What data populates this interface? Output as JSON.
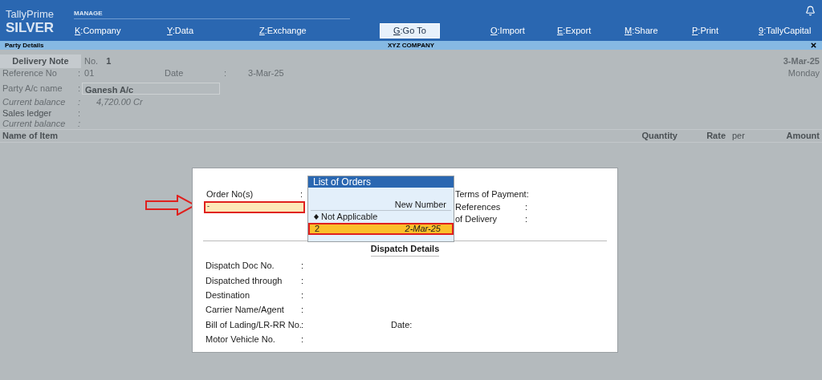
{
  "header": {
    "product": "TallyPrime",
    "edition": "SILVER",
    "section": "MANAGE",
    "menu": [
      {
        "key": "K",
        "label": ":Company",
        "selected": false
      },
      {
        "key": "Y",
        "label": ":Data",
        "selected": false
      },
      {
        "key": "Z",
        "label": ":Exchange",
        "selected": false
      },
      {
        "key": "G",
        "label": ":Go To",
        "selected": true
      },
      {
        "key": "O",
        "label": ":Import",
        "selected": false
      },
      {
        "key": "E",
        "label": ":Export",
        "selected": false
      },
      {
        "key": "M",
        "label": ":Share",
        "selected": false
      },
      {
        "key": "P",
        "label": ":Print",
        "selected": false
      },
      {
        "key": "9",
        "label": ":TallyCapital",
        "selected": false
      }
    ]
  },
  "title_bar": {
    "screen": "Party Details",
    "company": "XYZ COMPANY"
  },
  "voucher": {
    "type": "Delivery Note",
    "number_label": "No.",
    "number": "1",
    "date": "3-Mar-25",
    "day": "Monday",
    "reference_label": "Reference No",
    "reference_sep": ":",
    "reference": "01",
    "ref_date_label": "Date",
    "ref_date_sep": ":",
    "ref_date": "3-Mar-25",
    "party_label": "Party A/c name",
    "party_sep": ":",
    "party": "Ganesh A/c",
    "party_balance_label": "Current balance",
    "party_balance_sep": ":",
    "party_balance": "4,720.00 Cr",
    "ledger_label": "Sales ledger",
    "ledger_sep": ":",
    "ledger_balance_label": "Current balance",
    "ledger_balance_sep": ":",
    "columns": [
      "Name of Item",
      "Quantity",
      "Rate",
      "per",
      "Amount"
    ]
  },
  "order_dialog": {
    "order_label": "Order No(s)",
    "order_sep": ":",
    "order_cursor": "-",
    "right_fields": [
      {
        "label": "Terms of Payment:"
      },
      {
        "label": "References",
        "separator": ":"
      },
      {
        "label": "of Delivery",
        "separator": ":"
      }
    ],
    "list": {
      "title": "List of Orders",
      "header": "New Number",
      "items": [
        {
          "kind": "option",
          "label": "Not Applicable",
          "selected": false
        },
        {
          "kind": "order",
          "label": "2",
          "date": "2-Mar-25",
          "selected": true
        }
      ]
    },
    "dispatch_title": "Dispatch Details",
    "dispatch_fields": [
      {
        "label": "Dispatch Doc No.",
        "separator": ":"
      },
      {
        "label": "Dispatched through",
        "separator": ":"
      },
      {
        "label": "Destination",
        "separator": ":"
      },
      {
        "label": "Carrier Name/Agent",
        "separator": ":"
      },
      {
        "label": "Bill of Lading/LR-RR No.",
        "separator": ":",
        "extra": "Date:"
      },
      {
        "label": "Motor Vehicle No.",
        "separator": ":"
      }
    ]
  }
}
